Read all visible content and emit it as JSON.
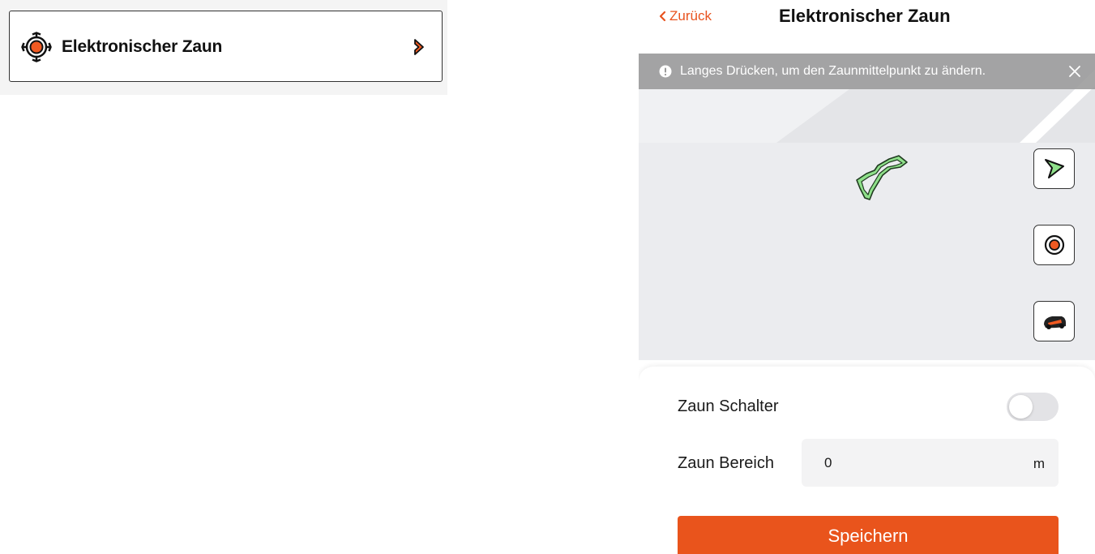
{
  "left_card": {
    "title": "Elektronischer Zaun",
    "icon": "target-icon",
    "chevron_icon": "chevron-right-icon",
    "accent": "#e8531f"
  },
  "nav": {
    "back_label": "Zurück",
    "title": "Elektronischer Zaun"
  },
  "banner": {
    "text": "Langes Drücken, um den Zaunmittelpunkt zu ändern.",
    "icon": "info-icon",
    "close_icon": "close-icon"
  },
  "map_controls": [
    {
      "name": "navigate-icon"
    },
    {
      "name": "fence-center-icon"
    },
    {
      "name": "mower-icon"
    }
  ],
  "settings": {
    "switch_label": "Zaun Schalter",
    "switch_on": false,
    "range_label": "Zaun Bereich",
    "range_value": "0",
    "range_unit": "m"
  },
  "save_label": "Speichern",
  "colors": {
    "accent": "#e9541c",
    "map_bg": "#ebecef",
    "fence_green": "#7ed67a"
  }
}
